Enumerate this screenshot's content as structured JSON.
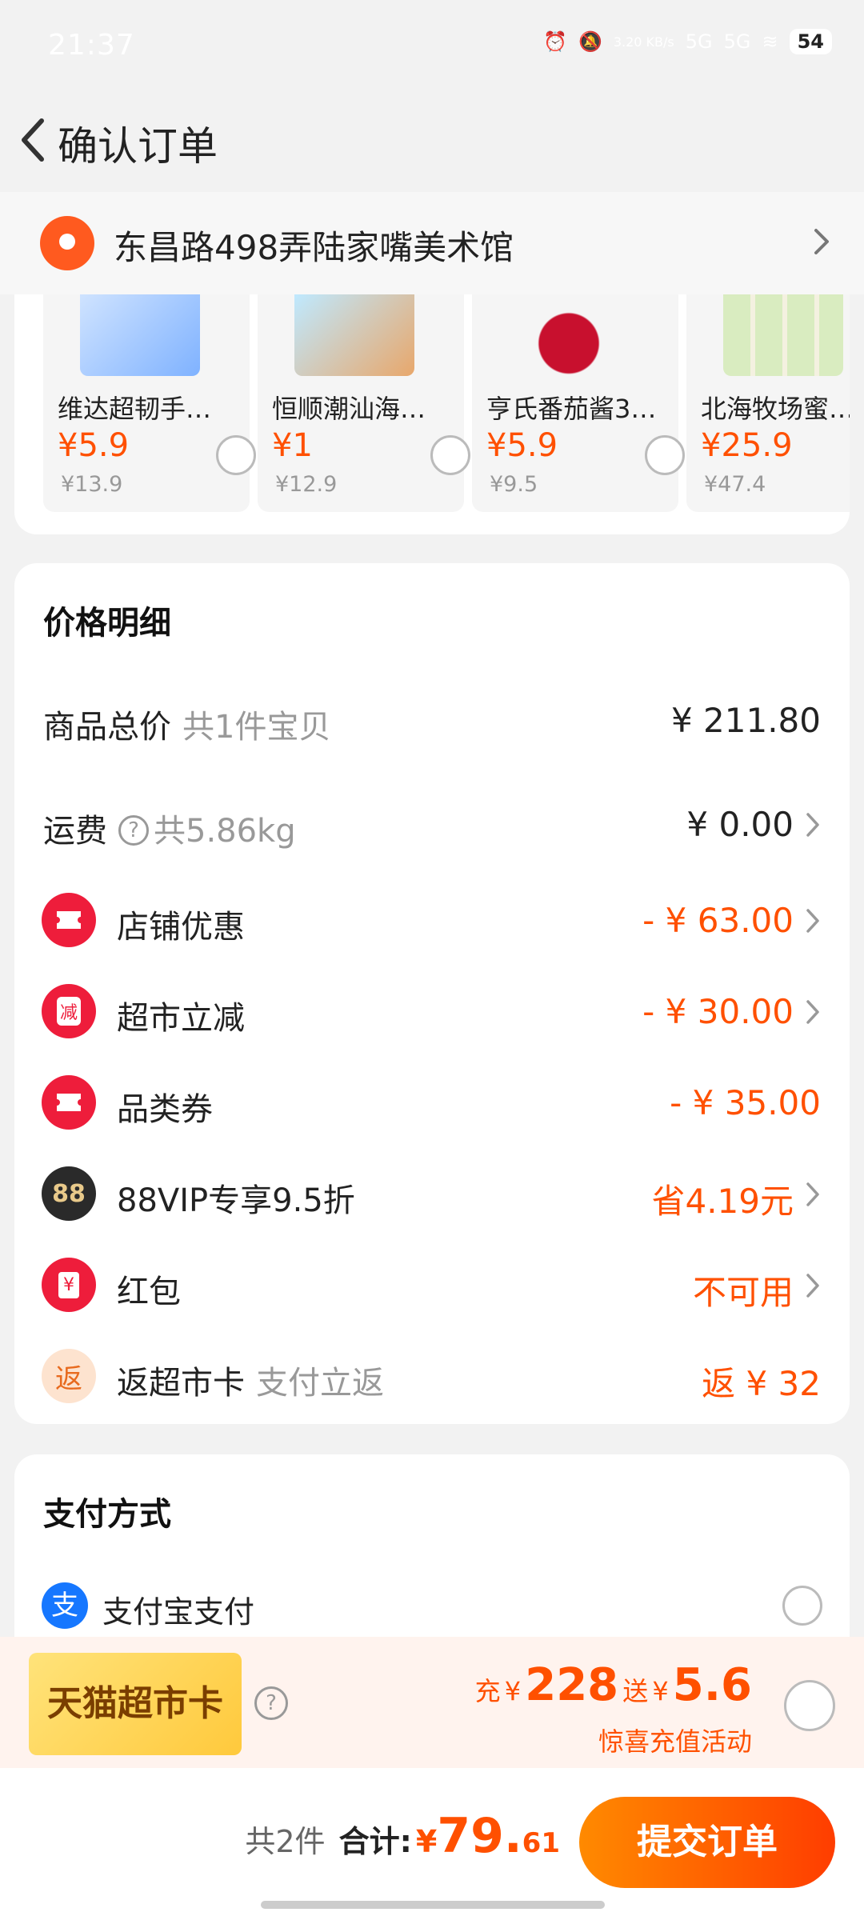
{
  "status_bar": {
    "time": "21:37",
    "net_speed": "3.20 KB/s",
    "signal_1": "5G",
    "signal_2": "5G",
    "battery": "54"
  },
  "header": {
    "title": "确认订单"
  },
  "address": {
    "text": "东昌路498弄陆家嘴美术馆"
  },
  "products": [
    {
      "name": "维达超韧手…",
      "price": "¥5.9",
      "original_price": "¥13.9"
    },
    {
      "name": "恒顺潮汕海…",
      "price": "¥1",
      "original_price": "¥12.9"
    },
    {
      "name": "亨氏番茄酱3…",
      "price": "¥5.9",
      "original_price": "¥9.5"
    },
    {
      "name": "北海牧场蜜…",
      "price": "¥25.9",
      "original_price": "¥47.4"
    }
  ],
  "price_details": {
    "title": "价格明细",
    "goods_total_label": "商品总价",
    "goods_total_sub": "共1件宝贝",
    "goods_total_value": "¥ 211.80",
    "shipping_label": "运费",
    "shipping_help": "?",
    "shipping_sub": "共5.86kg",
    "shipping_value": "¥ 0.00",
    "store_discount_label": "店铺优惠",
    "store_discount_value": "- ¥ 63.00",
    "supermarket_cut_label": "超市立减",
    "supermarket_cut_icon_text": "减",
    "supermarket_cut_value": "- ¥ 30.00",
    "category_coupon_label": "品类券",
    "category_coupon_value": "- ¥ 35.00",
    "vip_label": "88VIP专享9.5折",
    "vip_icon_text": "88",
    "vip_value": "省4.19元",
    "red_packet_label": "红包",
    "red_packet_icon_text": "¥",
    "red_packet_value": "不可用",
    "rebate_label": "返超市卡",
    "rebate_icon_text": "返",
    "rebate_sub": "支付立返",
    "rebate_value": "返 ¥ 32"
  },
  "payment": {
    "title": "支付方式",
    "alipay_icon_text": "支",
    "alipay_label": "支付宝支付"
  },
  "promo": {
    "card_name": "天猫超市卡",
    "help": "?",
    "charge_prefix": "充",
    "currency": "¥",
    "charge_amount": "228",
    "gift_prefix": "送",
    "gift_amount": "5.6",
    "subtitle": "惊喜充值活动"
  },
  "footer": {
    "count": "共2件",
    "total_label": "合计:",
    "currency": "¥",
    "total_integer": "79.",
    "total_decimal": "61",
    "submit_label": "提交订单"
  },
  "colors": {
    "accent": "#ff5000",
    "red_icon": "#ee1d3b",
    "alipay": "#1677ff"
  }
}
